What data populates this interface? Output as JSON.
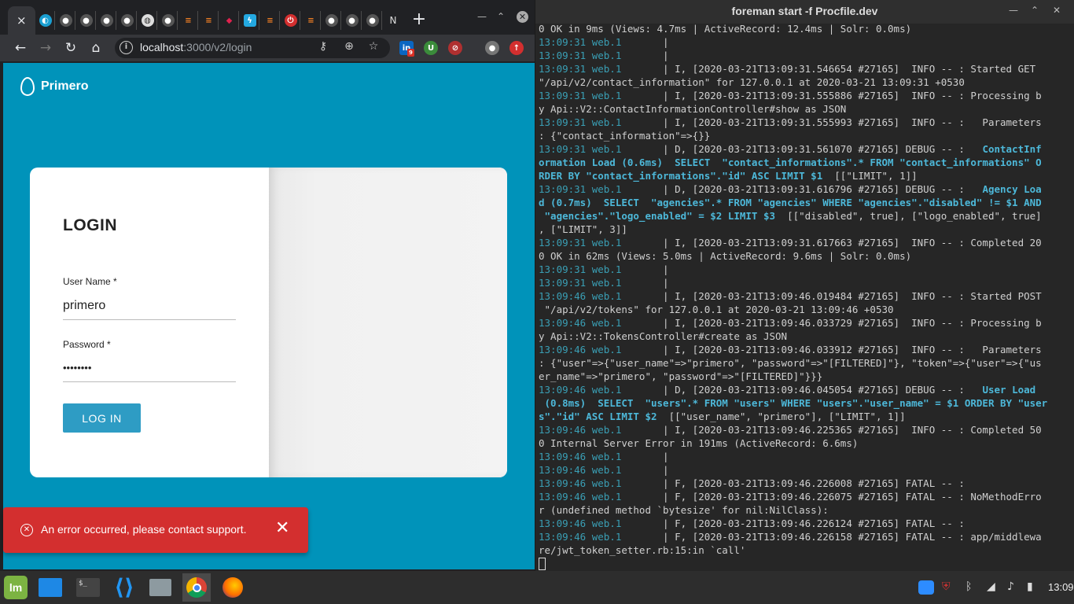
{
  "browser": {
    "tab_close": "×",
    "last_tab_letter": "N",
    "new_tab": "+",
    "url_host": "localhost",
    "url_path": ":3000/v2/login",
    "extension_badge": "9"
  },
  "page": {
    "brand": "Primero",
    "login_title": "LOGIN",
    "username_label": "User Name *",
    "username_value": "primero",
    "password_label": "Password *",
    "password_value": "••••••••",
    "login_button": "LOG IN",
    "snackbar_message": "An error occurred, please contact support.",
    "snackbar_close": "✕",
    "primary_color": "#0093ba",
    "error_color": "#d32f2f"
  },
  "terminal": {
    "title": "foreman start -f Procfile.dev",
    "lines": [
      [
        [
          "0 OK in 9ms (Views: 4.7ms | ActiveRecord: 12.4ms | Solr: 0.0ms)",
          ""
        ]
      ],
      [
        [
          "13:09:31 web.1",
          "ts"
        ],
        [
          "       |",
          ""
        ]
      ],
      [
        [
          "13:09:31 web.1",
          "ts"
        ],
        [
          "       |",
          ""
        ]
      ],
      [
        [
          "13:09:31 web.1",
          "ts"
        ],
        [
          "       | I, [2020-03-21T13:09:31.546654 #27165]  INFO -- : Started GET",
          ""
        ]
      ],
      [
        [
          "\"/api/v2/contact_information\" for 127.0.0.1 at 2020-03-21 13:09:31 +0530",
          ""
        ]
      ],
      [
        [
          "13:09:31 web.1",
          "ts"
        ],
        [
          "       | I, [2020-03-21T13:09:31.555886 #27165]  INFO -- : Processing b",
          ""
        ]
      ],
      [
        [
          "y Api::V2::ContactInformationController#show as JSON",
          ""
        ]
      ],
      [
        [
          "13:09:31 web.1",
          "ts"
        ],
        [
          "       | I, [2020-03-21T13:09:31.555993 #27165]  INFO -- :   Parameters",
          ""
        ]
      ],
      [
        [
          ": {\"contact_information\"=>{}}",
          ""
        ]
      ],
      [
        [
          "13:09:31 web.1",
          "ts"
        ],
        [
          "       | D, [2020-03-21T13:09:31.561070 #27165] DEBUG -- :   ",
          ""
        ],
        [
          "ContactInf",
          "sql"
        ]
      ],
      [
        [
          "ormation Load (0.6ms)  SELECT  \"contact_informations\".* FROM \"contact_informations\" O",
          "sql"
        ]
      ],
      [
        [
          "RDER BY \"contact_informations\".\"id\" ASC LIMIT $1",
          "sql"
        ],
        [
          "  [[\"LIMIT\", 1]]",
          ""
        ]
      ],
      [
        [
          "13:09:31 web.1",
          "ts"
        ],
        [
          "       | D, [2020-03-21T13:09:31.616796 #27165] DEBUG -- :   ",
          ""
        ],
        [
          "Agency Loa",
          "sql"
        ]
      ],
      [
        [
          "d (0.7ms)  SELECT  \"agencies\".* FROM \"agencies\" WHERE \"agencies\".\"disabled\" != $1 AND",
          "sql"
        ]
      ],
      [
        [
          " \"agencies\".\"logo_enabled\" = $2 LIMIT $3",
          "sql"
        ],
        [
          "  [[\"disabled\", true], [\"logo_enabled\", true]",
          ""
        ]
      ],
      [
        [
          ", [\"LIMIT\", 3]]",
          ""
        ]
      ],
      [
        [
          "13:09:31 web.1",
          "ts"
        ],
        [
          "       | I, [2020-03-21T13:09:31.617663 #27165]  INFO -- : Completed 20",
          ""
        ]
      ],
      [
        [
          "0 OK in 62ms (Views: 5.0ms | ActiveRecord: 9.6ms | Solr: 0.0ms)",
          ""
        ]
      ],
      [
        [
          "13:09:31 web.1",
          "ts"
        ],
        [
          "       |",
          ""
        ]
      ],
      [
        [
          "13:09:31 web.1",
          "ts"
        ],
        [
          "       |",
          ""
        ]
      ],
      [
        [
          "13:09:46 web.1",
          "ts"
        ],
        [
          "       | I, [2020-03-21T13:09:46.019484 #27165]  INFO -- : Started POST",
          ""
        ]
      ],
      [
        [
          " \"/api/v2/tokens\" for 127.0.0.1 at 2020-03-21 13:09:46 +0530",
          ""
        ]
      ],
      [
        [
          "13:09:46 web.1",
          "ts"
        ],
        [
          "       | I, [2020-03-21T13:09:46.033729 #27165]  INFO -- : Processing b",
          ""
        ]
      ],
      [
        [
          "y Api::V2::TokensController#create as JSON",
          ""
        ]
      ],
      [
        [
          "13:09:46 web.1",
          "ts"
        ],
        [
          "       | I, [2020-03-21T13:09:46.033912 #27165]  INFO -- :   Parameters",
          ""
        ]
      ],
      [
        [
          ": {\"user\"=>{\"user_name\"=>\"primero\", \"password\"=>\"[FILTERED]\"}, \"token\"=>{\"user\"=>{\"us",
          ""
        ]
      ],
      [
        [
          "er_name\"=>\"primero\", \"password\"=>\"[FILTERED]\"}}}",
          ""
        ]
      ],
      [
        [
          "13:09:46 web.1",
          "ts"
        ],
        [
          "       | D, [2020-03-21T13:09:46.045054 #27165] DEBUG -- :   ",
          ""
        ],
        [
          "User Load",
          "sql"
        ]
      ],
      [
        [
          " (0.8ms)  SELECT  \"users\".* FROM \"users\" WHERE \"users\".\"user_name\" = $1 ORDER BY \"user",
          "sql"
        ]
      ],
      [
        [
          "s\".\"id\" ASC LIMIT $2",
          "sql"
        ],
        [
          "  [[\"user_name\", \"primero\"], [\"LIMIT\", 1]]",
          ""
        ]
      ],
      [
        [
          "13:09:46 web.1",
          "ts"
        ],
        [
          "       | I, [2020-03-21T13:09:46.225365 #27165]  INFO -- : Completed 50",
          ""
        ]
      ],
      [
        [
          "0 Internal Server Error in 191ms (ActiveRecord: 6.6ms)",
          ""
        ]
      ],
      [
        [
          "13:09:46 web.1",
          "ts"
        ],
        [
          "       |",
          ""
        ]
      ],
      [
        [
          "13:09:46 web.1",
          "ts"
        ],
        [
          "       |",
          ""
        ]
      ],
      [
        [
          "13:09:46 web.1",
          "ts"
        ],
        [
          "       | F, [2020-03-21T13:09:46.226008 #27165] FATAL -- :",
          ""
        ]
      ],
      [
        [
          "13:09:46 web.1",
          "ts"
        ],
        [
          "       | F, [2020-03-21T13:09:46.226075 #27165] FATAL -- : NoMethodErro",
          ""
        ]
      ],
      [
        [
          "r (undefined method `bytesize' for nil:NilClass):",
          ""
        ]
      ],
      [
        [
          "13:09:46 web.1",
          "ts"
        ],
        [
          "       | F, [2020-03-21T13:09:46.226124 #27165] FATAL -- :",
          ""
        ]
      ],
      [
        [
          "13:09:46 web.1",
          "ts"
        ],
        [
          "       | F, [2020-03-21T13:09:46.226158 #27165] FATAL -- : app/middlewa",
          ""
        ]
      ],
      [
        [
          "re/jwt_token_setter.rb:15:in `call'",
          ""
        ]
      ]
    ]
  },
  "taskbar": {
    "terminal_glyph": "$_",
    "clock": "13:09"
  }
}
